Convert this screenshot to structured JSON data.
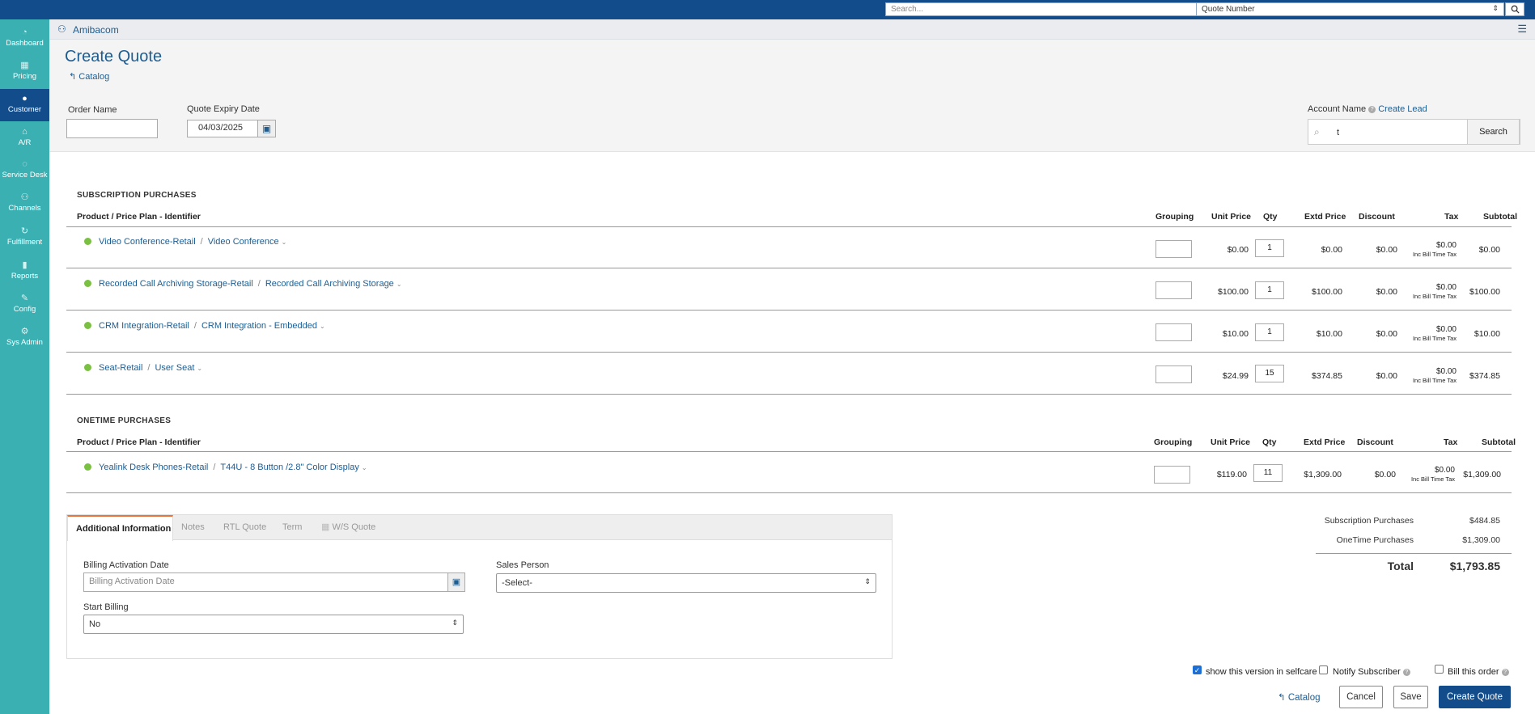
{
  "topbar": {
    "search_placeholder": "Search...",
    "search_type": "Quote Number"
  },
  "sidebar": {
    "items": [
      {
        "label": "Dashboard",
        "icon": "dashboard-icon"
      },
      {
        "label": "Pricing",
        "icon": "grid-icon"
      },
      {
        "label": "Customer",
        "icon": "user-icon",
        "active": true
      },
      {
        "label": "A/R",
        "icon": "bank-icon"
      },
      {
        "label": "Service Desk",
        "icon": "headset-icon"
      },
      {
        "label": "Channels",
        "icon": "people-icon"
      },
      {
        "label": "Fulfillment",
        "icon": "cycle-icon"
      },
      {
        "label": "Reports",
        "icon": "bar-chart-icon"
      },
      {
        "label": "Config",
        "icon": "wrench-icon"
      },
      {
        "label": "Sys Admin",
        "icon": "gear-icon"
      }
    ]
  },
  "header": {
    "account": "Amibacom",
    "title": "Create Quote",
    "back_link": "Catalog"
  },
  "form": {
    "order_name_label": "Order Name",
    "order_name_value": "",
    "expiry_label": "Quote Expiry Date",
    "expiry_value": "04/03/2025",
    "account_name_label": "Account Name",
    "create_lead": "Create Lead",
    "account_search_value": "t",
    "search_button": "Search"
  },
  "columns": {
    "product": "Product / Price Plan - Identifier",
    "grouping": "Grouping",
    "unit_price": "Unit Price",
    "qty": "Qty",
    "extd_price": "Extd Price",
    "discount": "Discount",
    "tax": "Tax",
    "subtotal": "Subtotal",
    "tax_note": "Inc Bill Time Tax"
  },
  "subscription": {
    "title": "SUBSCRIPTION PURCHASES",
    "rows": [
      {
        "product": "Video Conference-Retail",
        "plan": "Video Conference",
        "unit_price": "$0.00",
        "qty": "1",
        "extd_price": "$0.00",
        "discount": "$0.00",
        "tax": "$0.00",
        "subtotal": "$0.00"
      },
      {
        "product": "Recorded Call Archiving Storage-Retail",
        "plan": "Recorded Call Archiving Storage",
        "unit_price": "$100.00",
        "qty": "1",
        "extd_price": "$100.00",
        "discount": "$0.00",
        "tax": "$0.00",
        "subtotal": "$100.00"
      },
      {
        "product": "CRM Integration-Retail",
        "plan": "CRM Integration - Embedded",
        "unit_price": "$10.00",
        "qty": "1",
        "extd_price": "$10.00",
        "discount": "$0.00",
        "tax": "$0.00",
        "subtotal": "$10.00"
      },
      {
        "product": "Seat-Retail",
        "plan": "User Seat",
        "unit_price": "$24.99",
        "qty": "15",
        "extd_price": "$374.85",
        "discount": "$0.00",
        "tax": "$0.00",
        "subtotal": "$374.85"
      }
    ]
  },
  "onetime": {
    "title": "ONETIME PURCHASES",
    "rows": [
      {
        "product": "Yealink Desk Phones-Retail",
        "plan": "T44U - 8 Button /2.8\" Color Display",
        "unit_price": "$119.00",
        "qty": "11",
        "extd_price": "$1,309.00",
        "discount": "$0.00",
        "tax": "$0.00",
        "subtotal": "$1,309.00"
      }
    ]
  },
  "tabs": {
    "items": [
      "Additional Information",
      "Notes",
      "RTL Quote",
      "Term",
      "W/S Quote"
    ],
    "billing_activation_label": "Billing Activation Date",
    "billing_activation_placeholder": "Billing Activation Date",
    "start_billing_label": "Start Billing",
    "start_billing_value": "No",
    "sales_person_label": "Sales Person",
    "sales_person_value": "-Select-"
  },
  "summary": {
    "subscription_label": "Subscription Purchases",
    "subscription_value": "$484.85",
    "onetime_label": "OneTime Purchases",
    "onetime_value": "$1,309.00",
    "total_label": "Total",
    "total_value": "$1,793.85"
  },
  "options": {
    "show_selfcare": "show this version in selfcare",
    "show_selfcare_checked": true,
    "notify_subscriber": "Notify Subscriber",
    "bill_order": "Bill this order"
  },
  "actions": {
    "catalog": "Catalog",
    "cancel": "Cancel",
    "save": "Save",
    "create": "Create Quote"
  },
  "colors": {
    "topbar": "#134c8a",
    "sidebar": "#3bb0b3",
    "status_green": "#7ac142",
    "link": "#1d5d92"
  }
}
